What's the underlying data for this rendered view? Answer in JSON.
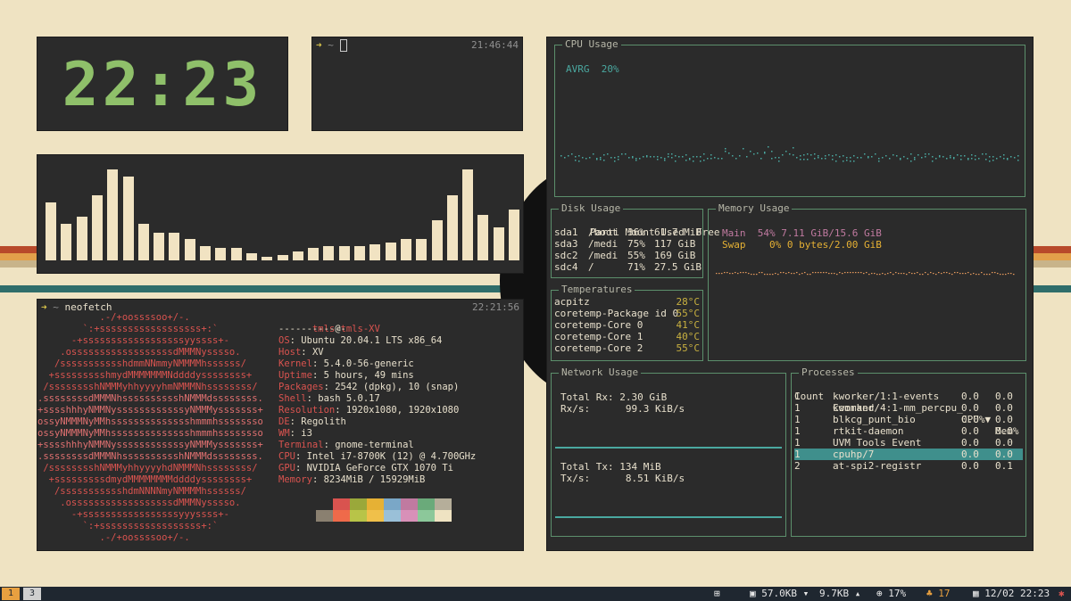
{
  "clock": {
    "time": "22:23"
  },
  "terminal_top": {
    "prompt": "~",
    "timestamp": "21:46:44"
  },
  "visualizer": {
    "levels": [
      0.64,
      0.4,
      0.48,
      0.72,
      1.0,
      0.92,
      0.4,
      0.3,
      0.3,
      0.24,
      0.16,
      0.14,
      0.14,
      0.08,
      0.04,
      0.06,
      0.1,
      0.14,
      0.16,
      0.16,
      0.16,
      0.18,
      0.2,
      0.24,
      0.24,
      0.44,
      0.72,
      1.0,
      0.5,
      0.36,
      0.56
    ]
  },
  "neofetch": {
    "prompt": "~",
    "command": "neofetch",
    "timestamp": "22:21:56",
    "user": "tmls",
    "at": "@",
    "host": "tmls-XV",
    "separator": "------------",
    "info": [
      {
        "key": "OS",
        "value": ": Ubuntu 20.04.1 LTS x86_64"
      },
      {
        "key": "Host",
        "value": ": XV"
      },
      {
        "key": "Kernel",
        "value": ": 5.4.0-56-generic"
      },
      {
        "key": "Uptime",
        "value": ": 5 hours, 49 mins"
      },
      {
        "key": "Packages",
        "value": ": 2542 (dpkg), 10 (snap)"
      },
      {
        "key": "Shell",
        "value": ": bash 5.0.17"
      },
      {
        "key": "Resolution",
        "value": ": 1920x1080, 1920x1080"
      },
      {
        "key": "DE",
        "value": ": Regolith"
      },
      {
        "key": "WM",
        "value": ": i3"
      },
      {
        "key": "Terminal",
        "value": ": gnome-terminal"
      },
      {
        "key": "CPU",
        "value": ": Intel i7-8700K (12) @ 4.700GHz"
      },
      {
        "key": "GPU",
        "value": ": NVIDIA GeForce GTX 1070 Ti"
      },
      {
        "key": "Memory",
        "value": ": 8234MiB / 15929MiB"
      }
    ],
    "logo": [
      "           .-/+oossssoo+/-.",
      "        `:+ssssssssssssssssss+:`",
      "      -+ssssssssssssssssssyyssss+-",
      "    .ossssssssssssssssssdMMMNysssso.",
      "   /ssssssssssshdmmNNmmyNMMMMhssssss/",
      "  +ssssssssshmydMMMMMMMNddddyssssssss+",
      " /sssssssshNMMMyhhyyyyhmNMMMNhssssssss/",
      ".ssssssssdMMMNhsssssssssshNMMMdssssssss.",
      "+sssshhhyNMMNyssssssssssssyNMMMysssssss+",
      "ossyNMMMNyMMhsssssssssssssshmmmhssssssso",
      "ossyNMMMNyMMhsssssssssssssshmmmhssssssso",
      "+sssshhhyNMMNyssssssssssssyNMMMysssssss+",
      ".ssssssssdMMMNhsssssssssshNMMMdssssssss.",
      " /sssssssshNMMMyhhyyyyhdNMMMNhssssssss/",
      "  +sssssssssdmydMMMMMMMMddddyssssssss+",
      "   /ssssssssssshdmNNNNmyNMMMMhssssss/",
      "    .ossssssssssssssssssdMMMNysssso.",
      "      -+sssssssssssssssssyyyssss+-",
      "        `:+ssssssssssssssssss+:`",
      "           .-/+oossssoo+/-."
    ],
    "palette_top": [
      "#2b2b2b",
      "#d9534f",
      "#9aa83a",
      "#e6b134",
      "#7aa7c7",
      "#c07aa0",
      "#6aaa7a",
      "#b5ae9a"
    ],
    "palette_bottom": [
      "#8a8070",
      "#ef6a4a",
      "#b8c448",
      "#f0c04a",
      "#9ac0d8",
      "#d890b8",
      "#8cc89a",
      "#efe3c2"
    ]
  },
  "cpu": {
    "title": "CPU Usage",
    "avg_label": "AVRG",
    "avg_value": "20%"
  },
  "disk": {
    "title": "Disk Usage",
    "headers": [
      "Parti",
      "Mount",
      "Used",
      "Free"
    ],
    "rows": [
      [
        "sda1",
        "/boot",
        "36%",
        "61.7 MiB"
      ],
      [
        "sda3",
        "/medi",
        "75%",
        "117 GiB"
      ],
      [
        "sdc2",
        "/medi",
        "55%",
        "169 GiB"
      ],
      [
        "sdc4",
        "/",
        "71%",
        "27.5 GiB"
      ]
    ]
  },
  "memory": {
    "title": "Memory Usage",
    "main_label": "Main",
    "main_value": "54% 7.11 GiB/15.6 GiB",
    "swap_label": "Swap",
    "swap_value": "0% 0 bytes/2.00 GiB"
  },
  "temps": {
    "title": "Temperatures",
    "rows": [
      [
        "acpitz",
        "28°C"
      ],
      [
        "coretemp-Package id 0",
        "55°C"
      ],
      [
        "coretemp-Core 0",
        "41°C"
      ],
      [
        "coretemp-Core 1",
        "40°C"
      ],
      [
        "coretemp-Core 2",
        "55°C"
      ]
    ]
  },
  "network": {
    "title": "Network Usage",
    "total_rx_label": "Total Rx:",
    "total_rx": "2.30 GiB",
    "rx_rate_label": "Rx/s:",
    "rx_rate": "99.3 KiB/s",
    "total_tx_label": "Total Tx:",
    "total_tx": "134 MiB",
    "tx_rate_label": "Tx/s:",
    "tx_rate": "8.51 KiB/s"
  },
  "processes": {
    "title": "Processes",
    "headers": [
      "Count",
      "Command",
      "CPU%▼",
      "Mem%"
    ],
    "rows": [
      [
        "1",
        "kworker/1:1-events",
        "0.0",
        "0.0"
      ],
      [
        "1",
        "kworker/4:1-mm_percpu_",
        "0.0",
        "0.0"
      ],
      [
        "1",
        "blkcg_punt_bio",
        "0.0",
        "0.0"
      ],
      [
        "1",
        "rtkit-daemon",
        "0.0",
        "0.0"
      ],
      [
        "1",
        "UVM Tools Event",
        "0.0",
        "0.0"
      ],
      [
        "1",
        "cpuhp/7",
        "0.0",
        "0.0"
      ],
      [
        "2",
        "at-spi2-registr",
        "0.0",
        "0.1"
      ]
    ],
    "selected_index": 5
  },
  "taskbar": {
    "workspaces": [
      "1",
      "3"
    ],
    "net_down": "57.0KB",
    "net_up": "9.7KB",
    "cpu": "17%",
    "notifications": "17",
    "datetime": "12/02 22:23",
    "add_icon": "plus-box-icon",
    "colors": {
      "active": "#e8a040",
      "bar": "#1f2730"
    }
  }
}
